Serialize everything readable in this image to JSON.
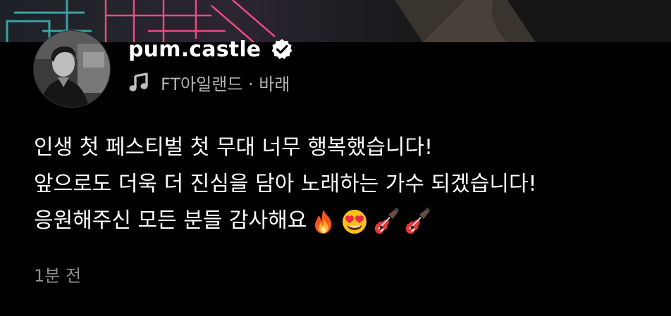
{
  "post": {
    "username": "pum.castle",
    "music": "FT아일랜드 · 바래",
    "caption_lines": [
      "인생 첫 페스티벌 첫 무대 너무 행복했습니다!",
      "앞으로도 더욱 더 진심을 담아 노래하는 가수 되겠습니다!",
      "응원해주신 모든 분들 감사해요"
    ],
    "caption_emojis": [
      "fire-emoji",
      "heart-eyes-emoji",
      "guitar-emoji",
      "guitar-emoji"
    ],
    "timestamp": "1분 전"
  },
  "icons": {
    "verified": "verified-badge-icon",
    "music": "music-note-icon",
    "avatar": "avatar"
  },
  "colors": {
    "background": "#000000",
    "text_primary": "#ffffff",
    "text_secondary": "#b3b3b3",
    "text_muted": "#8d8d8d",
    "neon_accent": "#ff4f8a",
    "teal_accent": "#3fb9b9"
  }
}
